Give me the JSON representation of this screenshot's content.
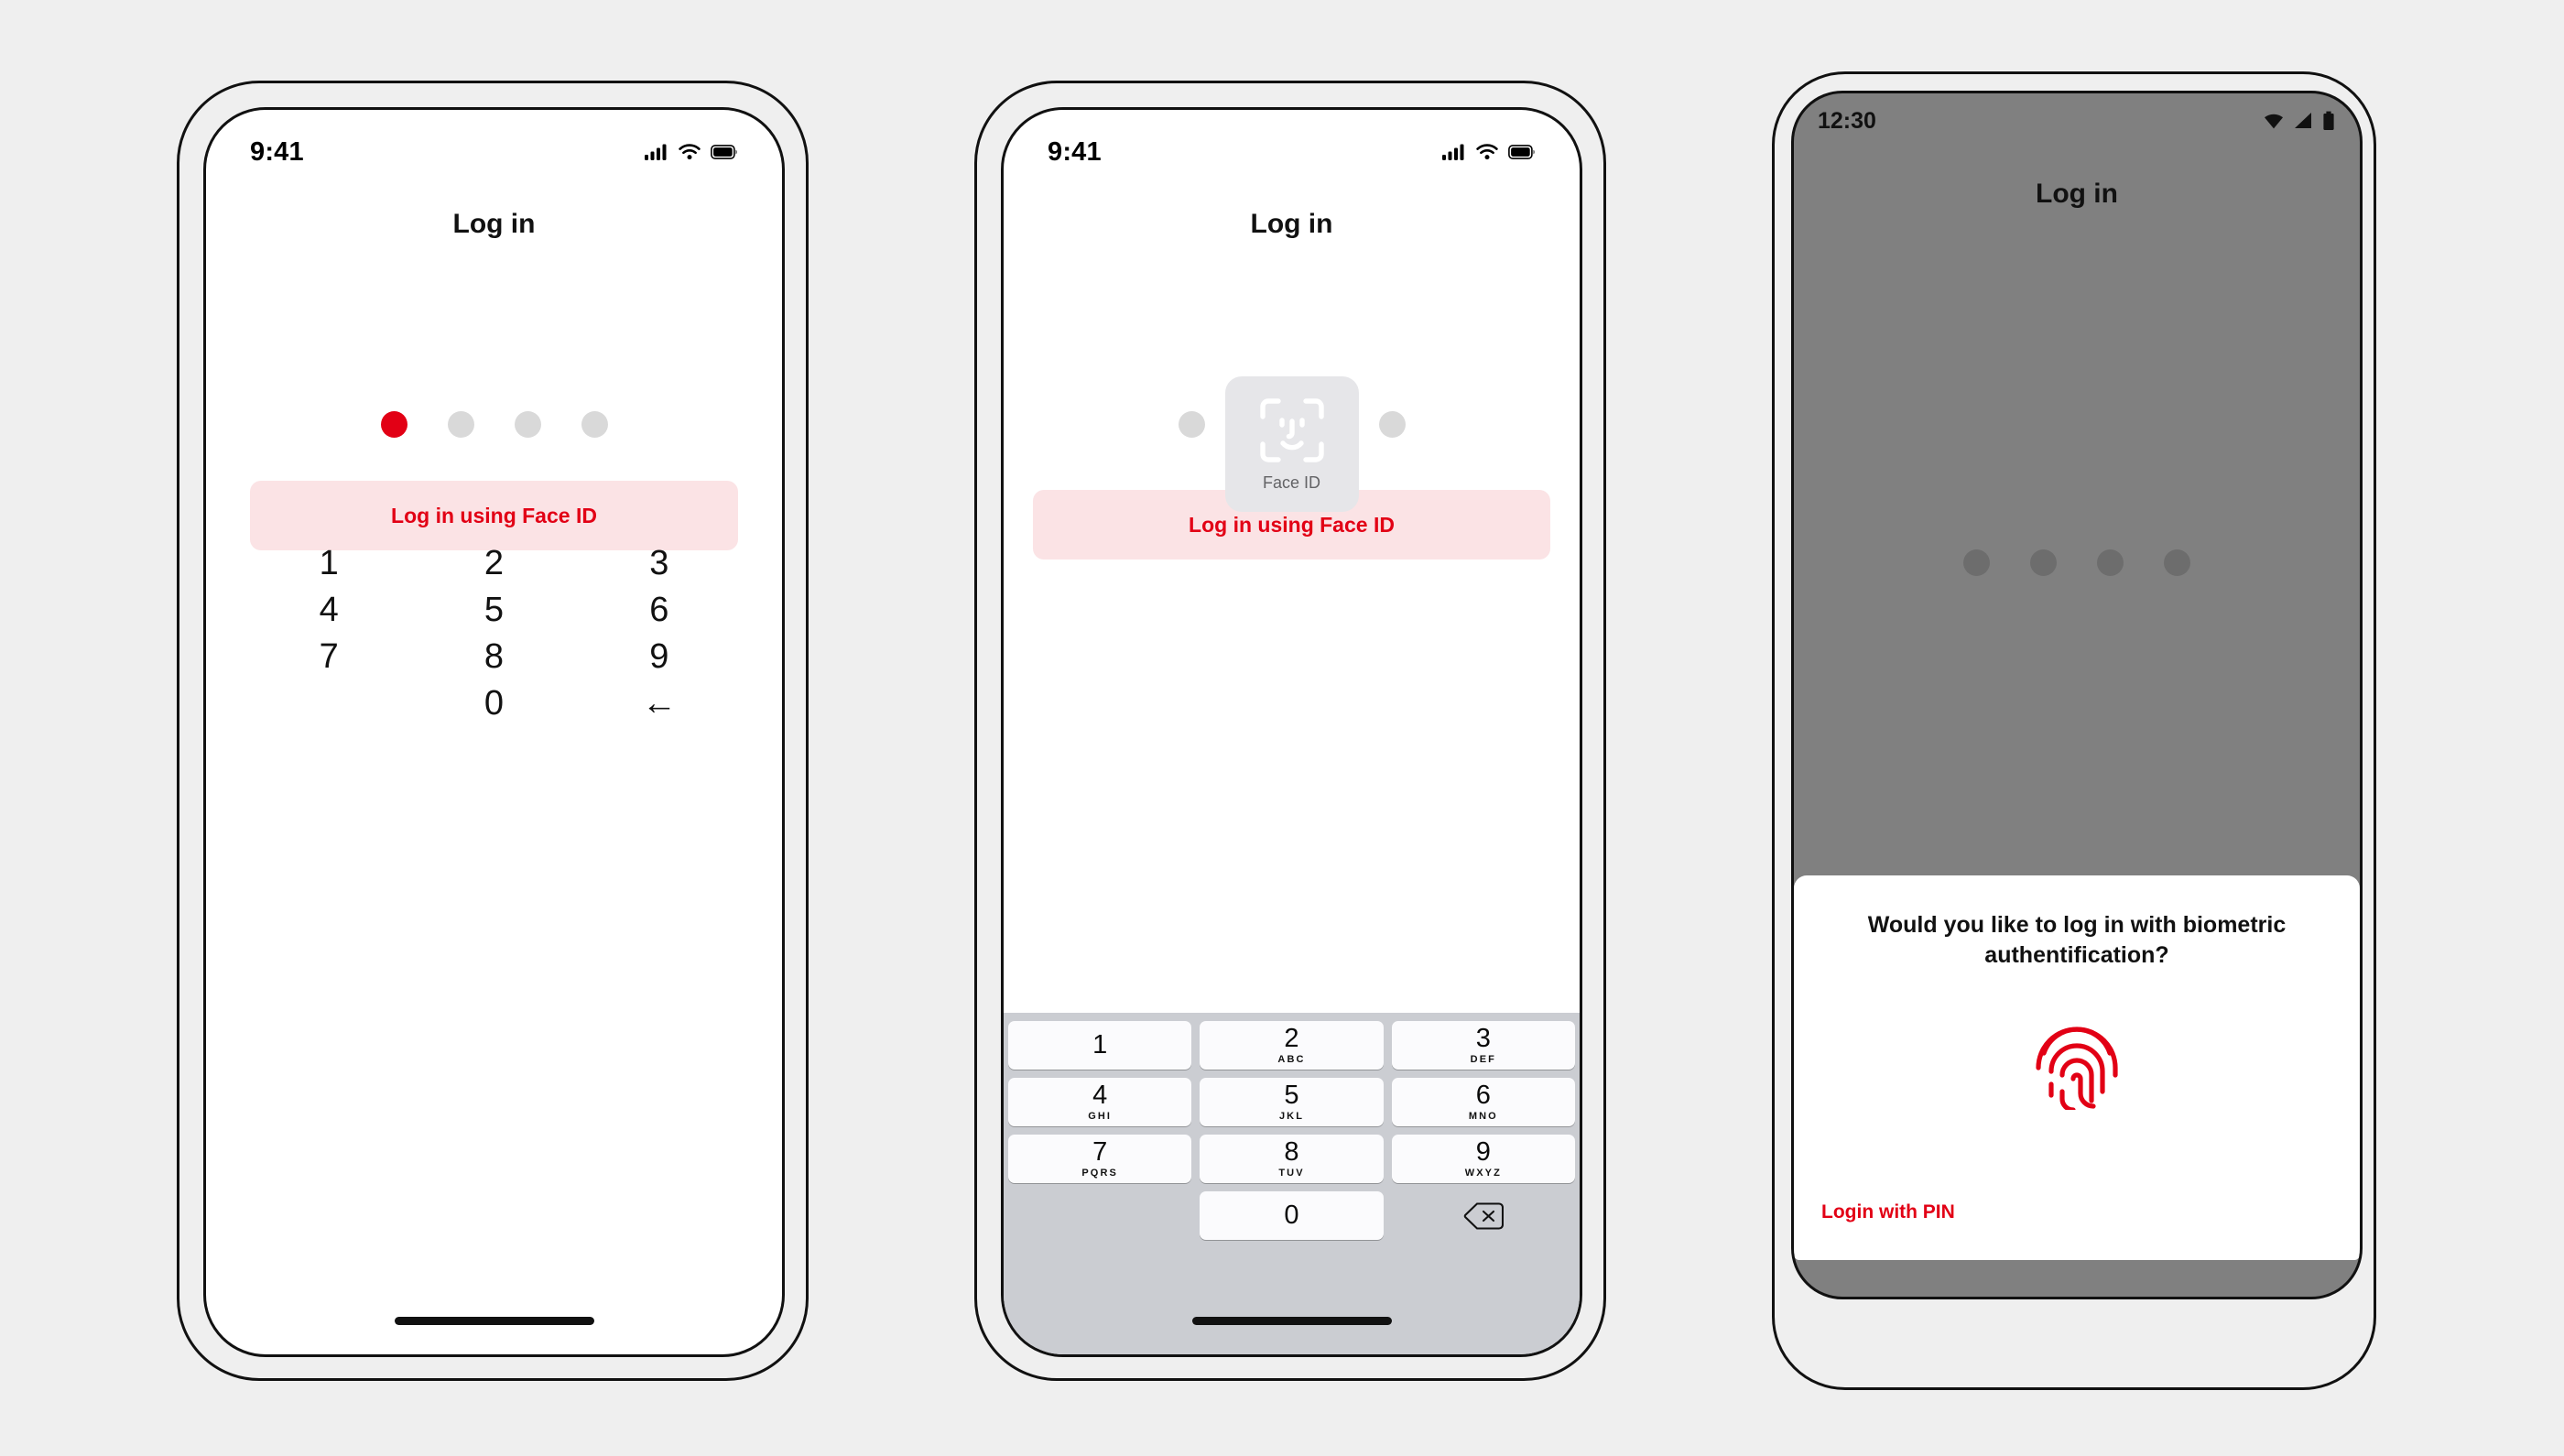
{
  "meta": {
    "background_color": "#efefef",
    "accent_red": "#e20015",
    "pink_bg": "#fbe3e5",
    "dot_grey": "#d9d9d9",
    "android_dim": "#808080"
  },
  "phone_ios_pin": {
    "status_bar": {
      "time": "9:41",
      "icons": [
        "cellular-signal-icon",
        "wifi-icon",
        "battery-icon"
      ]
    },
    "title": "Log in",
    "pin_dots": {
      "count": 4,
      "filled": 1,
      "filled_color": "#e20015",
      "empty_color": "#d9d9d9"
    },
    "face_id_button": {
      "label": "Log in using Face ID"
    },
    "keypad": {
      "keys": [
        "1",
        "2",
        "3",
        "4",
        "5",
        "6",
        "7",
        "8",
        "9",
        "",
        "0",
        "←"
      ],
      "backspace_glyph": "←"
    },
    "home_indicator": true
  },
  "phone_ios_faceid": {
    "status_bar": {
      "time": "9:41",
      "icons": [
        "cellular-signal-icon",
        "wifi-icon",
        "battery-icon"
      ]
    },
    "title": "Log in",
    "pin_dots": {
      "count": 4,
      "filled": 0,
      "empty_color": "#d9d9d9"
    },
    "face_id_button": {
      "label": "Log in using Face ID"
    },
    "face_id_overlay": {
      "label": "Face ID",
      "icon": "face-id-scan-icon",
      "card_color": "#e6e6e9"
    },
    "keyboard": {
      "background": "#cbcdd2",
      "keys": [
        {
          "num": "1",
          "letters": ""
        },
        {
          "num": "2",
          "letters": "ABC"
        },
        {
          "num": "3",
          "letters": "DEF"
        },
        {
          "num": "4",
          "letters": "GHI"
        },
        {
          "num": "5",
          "letters": "JKL"
        },
        {
          "num": "6",
          "letters": "MNO"
        },
        {
          "num": "7",
          "letters": "PQRS"
        },
        {
          "num": "8",
          "letters": "TUV"
        },
        {
          "num": "9",
          "letters": "WXYZ"
        },
        {
          "num": "",
          "letters": ""
        },
        {
          "num": "0",
          "letters": ""
        },
        {
          "num": "delete-icon",
          "letters": ""
        }
      ]
    },
    "home_indicator": true
  },
  "phone_android": {
    "status_bar": {
      "time": "12:30",
      "icons": [
        "wifi-icon",
        "cellular-signal-icon",
        "battery-icon"
      ]
    },
    "title": "Log in",
    "pin_dots": {
      "count": 4,
      "filled": 0,
      "empty_color": "#6d6d6d"
    },
    "dialog": {
      "title": "Would you like to log in with biometric authentification?",
      "icon": "fingerprint-icon",
      "icon_color": "#e20015",
      "action_label": "Login with PIN"
    }
  }
}
